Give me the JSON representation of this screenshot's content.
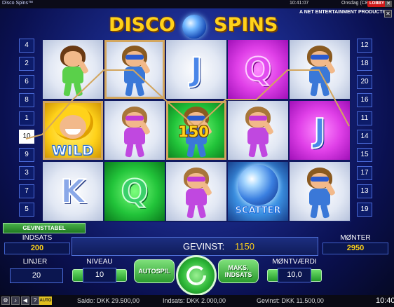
{
  "topbar": {
    "app_title": "Disco Spins™",
    "clock": "10:41:07",
    "day": "Onsdag (CET)",
    "lobby_label": "LOBBY",
    "close_glyph": "✕"
  },
  "producer": "A NET ENTERTAINMENT PRODUCTION",
  "close_button_glyph": "✕",
  "logo": {
    "word1": "DISCO",
    "word2": "SPINS"
  },
  "lines_left": [
    "4",
    "2",
    "6",
    "8",
    "1",
    "10",
    "9",
    "3",
    "7",
    "5"
  ],
  "lines_right": [
    "12",
    "18",
    "20",
    "16",
    "11",
    "14",
    "15",
    "17",
    "13",
    "19"
  ],
  "active_line": "10",
  "reels": [
    [
      {
        "symbol": "woman-green",
        "bg": "grey"
      },
      {
        "symbol": "wild",
        "bg": "yellow",
        "label": "WILD",
        "win": true
      },
      {
        "symbol": "K",
        "bg": "grey"
      }
    ],
    [
      {
        "symbol": "man",
        "bg": "grey",
        "win": true
      },
      {
        "symbol": "woman-purple",
        "bg": "grey"
      },
      {
        "symbol": "Q",
        "bg": "green"
      }
    ],
    [
      {
        "symbol": "J",
        "bg": "grey"
      },
      {
        "symbol": "man",
        "bg": "green",
        "win": true
      },
      {
        "symbol": "woman-purple",
        "bg": "grey"
      }
    ],
    [
      {
        "symbol": "Q",
        "bg": "purple"
      },
      {
        "symbol": "woman-purple",
        "bg": "grey"
      },
      {
        "symbol": "scatter",
        "bg": "blue",
        "label": "SCATTER"
      }
    ],
    [
      {
        "symbol": "man",
        "bg": "grey"
      },
      {
        "symbol": "J",
        "bg": "purple"
      },
      {
        "symbol": "man",
        "bg": "grey"
      }
    ]
  ],
  "win_amount": "150",
  "controls": {
    "paytable_label": "GEVINSTTABEL",
    "bet_label": "INDSATS",
    "bet_value": "200",
    "win_label": "GEVINST:",
    "win_value": "1150",
    "coins_label": "MØNTER",
    "coins_value": "2950",
    "lines_label": "LINJER",
    "lines_value": "20",
    "level_label": "NIVEAU",
    "level_value": "10",
    "autoplay_label": "AUTOSPIL",
    "max_bet_label": "MAKS. INDSATS",
    "coin_value_label": "MØNTVÆRDI",
    "coin_value": "10,0"
  },
  "statusbar": {
    "auto_label": "AUTO",
    "saldo": "Saldo: DKK 29.500,00",
    "indsats": "Indsats: DKK 2.000,00",
    "gevinst": "Gevinst: DKK 11.500,00",
    "time": "10:40"
  },
  "colors": {
    "gold": "#ffd21a",
    "panel_border": "#d3a65e",
    "button_green": "#2eb838"
  }
}
